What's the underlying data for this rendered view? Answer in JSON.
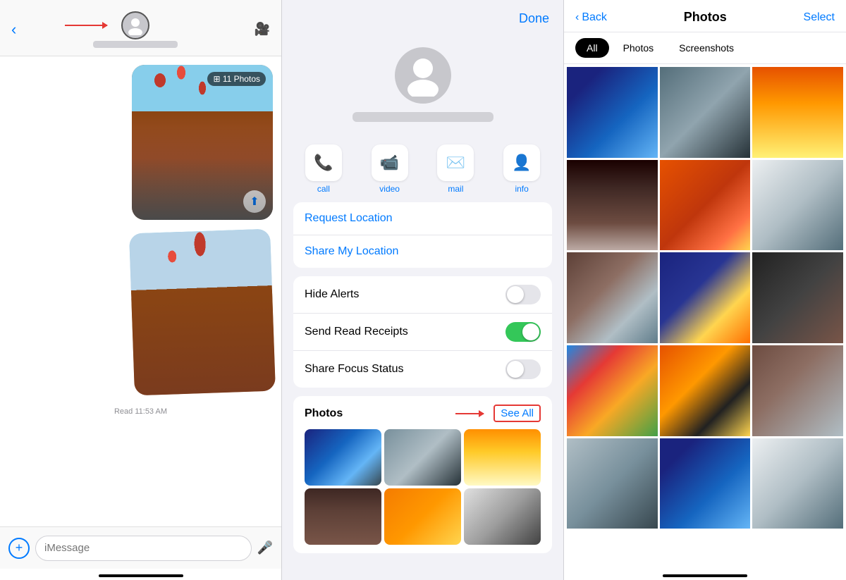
{
  "chat": {
    "back_label": "‹",
    "video_icon": "📹",
    "contact_name_blur": "",
    "photo_count": "⊞ 11 Photos",
    "read_label": "Read 11:53 AM",
    "input_placeholder": "iMessage",
    "add_icon": "+",
    "mic_icon": "🎤"
  },
  "info": {
    "done_label": "Done",
    "actions": [
      {
        "icon": "📞",
        "label": "call"
      },
      {
        "icon": "📹",
        "label": "video"
      },
      {
        "icon": "✉️",
        "label": "mail"
      },
      {
        "icon": "👤",
        "label": "info"
      }
    ],
    "menu_items": [
      {
        "text": "Request Location"
      },
      {
        "text": "Share My Location"
      }
    ],
    "toggles": [
      {
        "label": "Hide Alerts",
        "state": "off"
      },
      {
        "label": "Send Read Receipts",
        "state": "on"
      },
      {
        "label": "Share Focus Status",
        "state": "off"
      }
    ],
    "photos_title": "Photos",
    "see_all_label": "See All"
  },
  "photos": {
    "back_label": "Back",
    "title": "Photos",
    "select_label": "Select",
    "tabs": [
      {
        "label": "All",
        "active": true
      },
      {
        "label": "Photos",
        "active": false
      },
      {
        "label": "Screenshots",
        "active": false
      }
    ]
  }
}
